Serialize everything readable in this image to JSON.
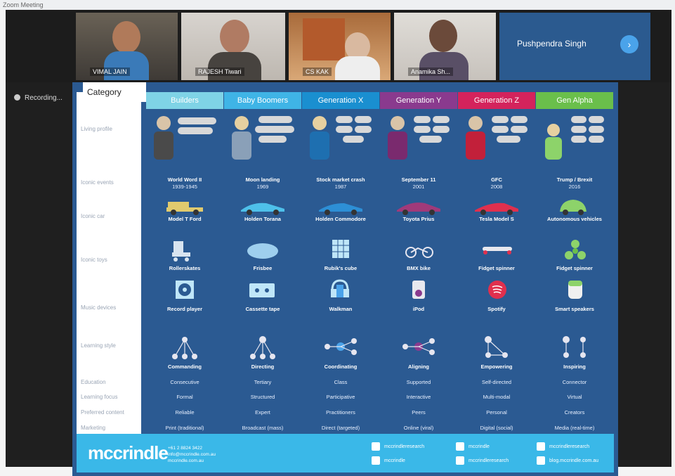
{
  "window": {
    "title": "Zoom Meeting"
  },
  "recording": {
    "label": "Recording..."
  },
  "participants": [
    {
      "name": "VIMAL JAIN"
    },
    {
      "name": "RAJESH Tiwari"
    },
    {
      "name": "CS KAK"
    },
    {
      "name": "Anamika Sh..."
    }
  ],
  "active_speaker": {
    "name": "Pushpendra Singh"
  },
  "slide": {
    "category_label": "Category",
    "generations": [
      {
        "label": "Builders",
        "color": "#7fd3e6"
      },
      {
        "label": "Baby Boomers",
        "color": "#3fb4e6"
      },
      {
        "label": "Generation X",
        "color": "#1a8fd0"
      },
      {
        "label": "Generation Y",
        "color": "#8a3a8e"
      },
      {
        "label": "Generation Z",
        "color": "#d4235c"
      },
      {
        "label": "Gen Alpha",
        "color": "#6abf4b"
      }
    ],
    "row_labels": [
      "Living profile",
      "Iconic events",
      "Iconic car",
      "Iconic toys",
      "Music devices",
      "Learning style",
      "Education",
      "Learning focus",
      "Preferred content",
      "Marketing"
    ],
    "iconic_events": [
      "World Word II",
      "Moon landing",
      "Stock market crash",
      "September 11",
      "GFC",
      "Trump / Brexit"
    ],
    "iconic_events_years": [
      "1939-1945",
      "1969",
      "1987",
      "2001",
      "2008",
      "2016"
    ],
    "iconic_cars": [
      "Model T Ford",
      "Holden Torana",
      "Holden Commodore",
      "Toyota Prius",
      "Tesla Model S",
      "Autonomous vehicles"
    ],
    "iconic_toys": [
      "Rollerskates",
      "Frisbee",
      "Rubik's cube",
      "BMX bike",
      "Fidget spinner",
      "Fidget spinner"
    ],
    "music_devices": [
      "Record player",
      "Cassette tape",
      "Walkman",
      "iPod",
      "Spotify",
      "Smart speakers"
    ],
    "learning_styles": [
      "Commanding",
      "Directing",
      "Coordinating",
      "Aligning",
      "Empowering",
      "Inspiring"
    ],
    "education": [
      "Consecutive",
      "Tertiary",
      "Class",
      "Supported",
      "Self-directed",
      "Connector"
    ],
    "learning_focus": [
      "Formal",
      "Structured",
      "Participative",
      "Interactive",
      "Multi-modal",
      "Virtual"
    ],
    "preferred_content": [
      "Reliable",
      "Expert",
      "Practitioners",
      "Peers",
      "Personal",
      "Creators"
    ],
    "marketing": [
      "Print (traditional)",
      "Broadcast (mass)",
      "Direct (targeted)",
      "Online (viral)",
      "Digital (social)",
      "Media (real-time)"
    ],
    "footer": {
      "brand": "mccrindle",
      "phone": "+61 2 8824 3422",
      "email": "info@mccrindle.com.au",
      "web": "mccrindle.com.au",
      "facebook": "mccrindleresearch",
      "twitter": "mccrindle",
      "linkedin": "mccrindle",
      "instagram": "mccrindleresearch",
      "youtube": "mccrindleresearch",
      "blog": "blog.mccrindle.com.au"
    }
  }
}
